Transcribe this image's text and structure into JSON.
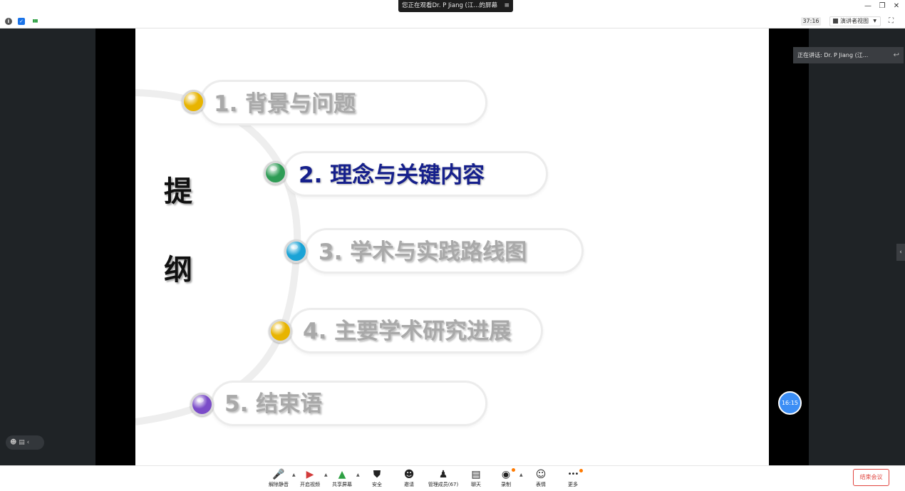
{
  "window": {
    "share_banner": "您正在观看Dr. P Jiang (江...的屏幕",
    "menu_glyph": "≡",
    "minimize_glyph": "—",
    "restore_glyph": "❐",
    "close_glyph": "✕"
  },
  "toolbar": {
    "info_glyph": "i",
    "shield_glyph": "✓",
    "signal_glyph": "▮▮▮",
    "timer": "37:16",
    "view_label": "演讲者视图",
    "view_caret": "▼",
    "fullscreen_glyph": "⛶",
    "colors": {
      "shield": "#1a73e8",
      "signal": "#2ea043",
      "info": "#555555"
    }
  },
  "slide": {
    "outline_chars": [
      "提",
      "纲"
    ],
    "items": [
      {
        "label": "1. 背景与问题",
        "color": "#e8b400",
        "active": false
      },
      {
        "label": "2. 理念与关键内容",
        "color": "#2e9c55",
        "active": true
      },
      {
        "label": "3. 学术与实践路线图",
        "color": "#1aa3d6",
        "active": false
      },
      {
        "label": "4. 主要学术研究进展",
        "color": "#e8b400",
        "active": false
      },
      {
        "label": "5. 结束语",
        "color": "#7a4bc8",
        "active": false
      }
    ]
  },
  "speaker": {
    "text": "正在讲话: Dr. P Jiang (江...",
    "arrow_glyph": "↩"
  },
  "side_collapse_glyph": "‹",
  "clock_badge": "16:15",
  "mini_controls": "☻ ▤  ‹",
  "bottom": {
    "buttons": [
      {
        "glyph": "🎤",
        "label": "解除静音"
      },
      {
        "glyph": "▶",
        "label": "开启视频"
      },
      {
        "glyph": "▲",
        "label": "共享屏幕"
      },
      {
        "glyph": "⛊",
        "label": "安全"
      },
      {
        "glyph": "☻",
        "label": "邀请"
      },
      {
        "glyph": "♟",
        "label": "管理成员(67)"
      },
      {
        "glyph": "▤",
        "label": "聊天"
      },
      {
        "glyph": "◉",
        "label": "录制"
      },
      {
        "glyph": "☺",
        "label": "表情"
      },
      {
        "glyph": "•••",
        "label": "更多"
      }
    ],
    "caret_glyph": "▲",
    "end_label": "结束会议"
  }
}
